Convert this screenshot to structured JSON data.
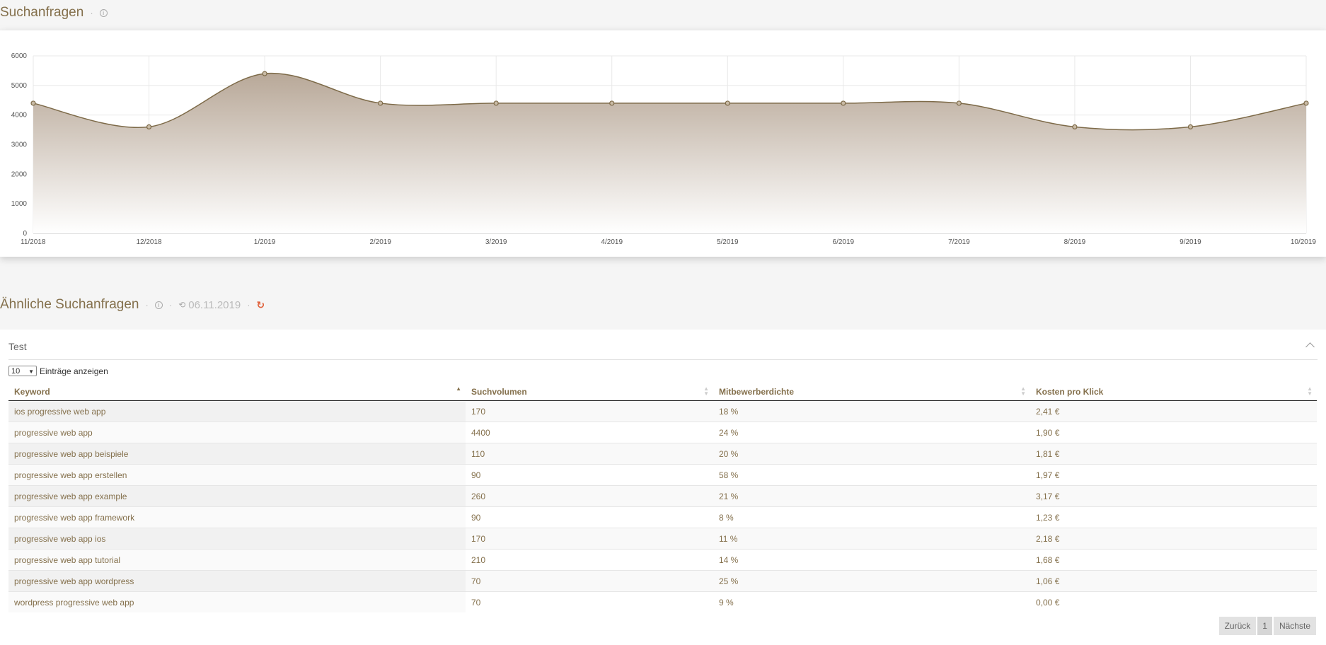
{
  "search_section": {
    "title": "Suchanfragen",
    "separator": "·",
    "info_icon": "info-circle-icon"
  },
  "chart_data": {
    "type": "area",
    "x": [
      "11/2018",
      "12/2018",
      "1/2019",
      "2/2019",
      "3/2019",
      "4/2019",
      "5/2019",
      "6/2019",
      "7/2019",
      "8/2019",
      "9/2019",
      "10/2019"
    ],
    "values": [
      4400,
      3600,
      5400,
      4400,
      4400,
      4400,
      4400,
      4400,
      4400,
      3600,
      3600,
      4400
    ],
    "yticks": [
      "0",
      "1000",
      "2000",
      "3000",
      "4000",
      "5000",
      "6000"
    ],
    "ylim": [
      0,
      6000
    ],
    "grid": true,
    "colors": {
      "line": "#7d6a48",
      "fill_top": "#b8a898",
      "fill_bottom": "#ffffff"
    }
  },
  "similar_section": {
    "title": "Ähnliche Suchanfragen",
    "separator": "·",
    "date": "06.11.2019",
    "info_icon": "info-circle-icon",
    "history_icon": "history-icon",
    "refresh_icon": "refresh-icon",
    "refresh_color": "#e0603a"
  },
  "panel": {
    "title": "Test",
    "collapse_icon": "chevron-up-icon"
  },
  "length_control": {
    "selected": "10",
    "label": "Einträge anzeigen"
  },
  "table": {
    "columns": [
      "Keyword",
      "Suchvolumen",
      "Mitbewerberdichte",
      "Kosten pro Klick"
    ],
    "sorted_column": "Keyword",
    "rows": [
      [
        "ios progressive web app",
        "170",
        "18 %",
        "2,41 €"
      ],
      [
        "progressive web app",
        "4400",
        "24 %",
        "1,90 €"
      ],
      [
        "progressive web app beispiele",
        "110",
        "20 %",
        "1,81 €"
      ],
      [
        "progressive web app erstellen",
        "90",
        "58 %",
        "1,97 €"
      ],
      [
        "progressive web app example",
        "260",
        "21 %",
        "3,17 €"
      ],
      [
        "progressive web app framework",
        "90",
        "8 %",
        "1,23 €"
      ],
      [
        "progressive web app ios",
        "170",
        "11 %",
        "2,18 €"
      ],
      [
        "progressive web app tutorial",
        "210",
        "14 %",
        "1,68 €"
      ],
      [
        "progressive web app wordpress",
        "70",
        "25 %",
        "1,06 €"
      ],
      [
        "wordpress progressive web app",
        "70",
        "9 %",
        "0,00 €"
      ]
    ]
  },
  "pagination": {
    "prev": "Zurück",
    "page": "1",
    "next": "Nächste"
  },
  "accent_color": "#84704c"
}
